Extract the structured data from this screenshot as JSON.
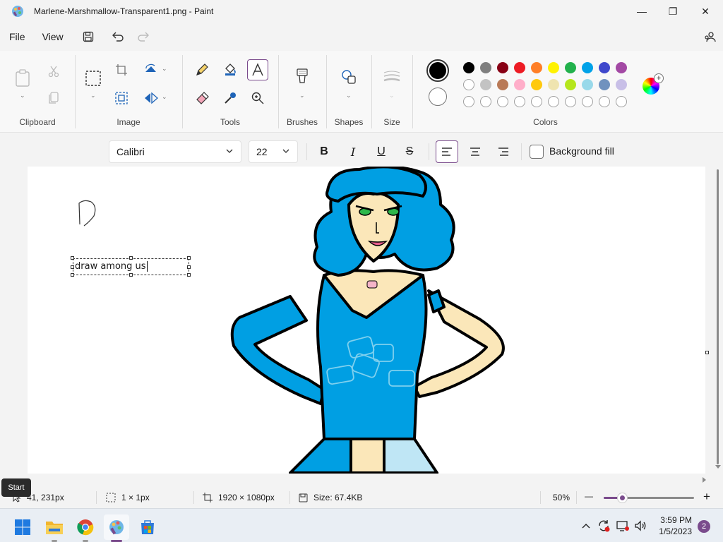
{
  "window": {
    "title": "Marlene-Marshmallow-Transparent1.png - Paint",
    "minimize_glyph": "—",
    "restore_glyph": "❐",
    "close_glyph": "✕"
  },
  "menu": {
    "file": "File",
    "view": "View"
  },
  "ribbon": {
    "clipboard_label": "Clipboard",
    "image_label": "Image",
    "tools_label": "Tools",
    "brushes_label": "Brushes",
    "shapes_label": "Shapes",
    "size_label": "Size",
    "colors_label": "Colors"
  },
  "colors": {
    "primary": "#000000",
    "secondary": "#ffffff",
    "accent": "#7a4b8c",
    "row1": [
      "#000000",
      "#7f7f7f",
      "#880015",
      "#ed1c24",
      "#ff7f27",
      "#fff200",
      "#22b14c",
      "#00a2e8",
      "#3f48cc",
      "#a349a4"
    ],
    "row2": [
      "#ffffff",
      "#c3c3c3",
      "#b97a57",
      "#ffaec9",
      "#ffc90e",
      "#efe4b0",
      "#b5e61d",
      "#99d9ea",
      "#7092be",
      "#c8bfe7"
    ],
    "row3_empty_count": 10
  },
  "textbar": {
    "font": "Calibri",
    "size": "22",
    "bold": "B",
    "italic": "I",
    "underline": "U",
    "strike": "S",
    "background_fill": "Background fill"
  },
  "canvas": {
    "text_content": "draw among us"
  },
  "status": {
    "cursor_pos": "41, 231px",
    "selection_size": "1 × 1px",
    "image_size": "1920 × 1080px",
    "file_size": "Size: 67.4KB",
    "zoom": "50%",
    "zoom_fraction": 0.2,
    "minus": "—",
    "plus": "+"
  },
  "tooltip": {
    "text": "Start"
  },
  "taskbar": {
    "time": "3:59 PM",
    "date": "1/5/2023",
    "notification_count": "2"
  }
}
